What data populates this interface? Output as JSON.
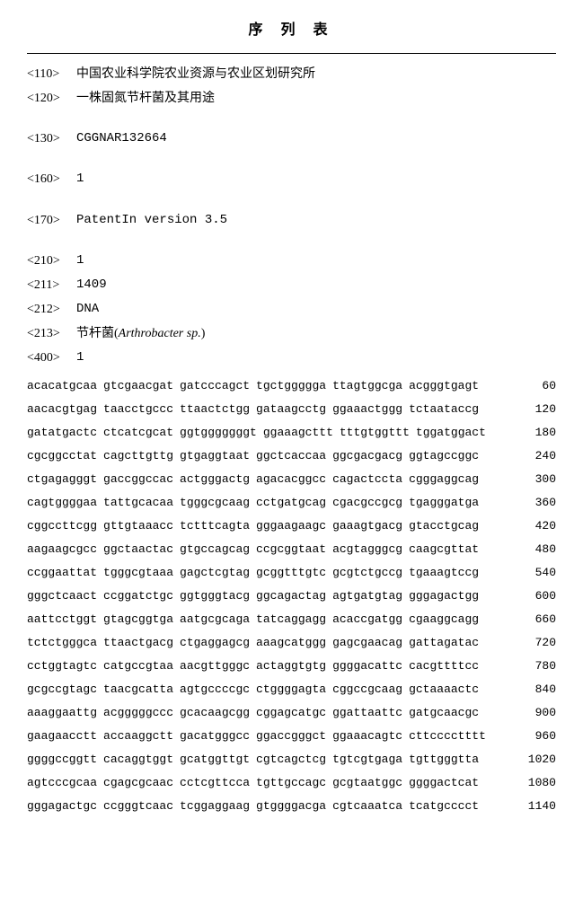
{
  "title": "序  列  表",
  "header": {
    "h110": {
      "tag": "<110>",
      "value": "中国农业科学院农业资源与农业区划研究所"
    },
    "h120": {
      "tag": "<120>",
      "value": "一株固氮节杆菌及其用途"
    },
    "h130": {
      "tag": "<130>",
      "value": "CGGNAR132664"
    },
    "h160": {
      "tag": "<160>",
      "value": "1"
    },
    "h170": {
      "tag": "<170>",
      "value": "PatentIn version 3.5"
    },
    "h210": {
      "tag": "<210>",
      "value": "1"
    },
    "h211": {
      "tag": "<211>",
      "value": "1409"
    },
    "h212": {
      "tag": "<212>",
      "value": "DNA"
    },
    "h213": {
      "tag": "<213>",
      "value_prefix": "节杆菌(",
      "value_italic": "Arthrobacter sp.",
      "value_suffix": ")"
    },
    "h400": {
      "tag": "<400>",
      "value": "1"
    }
  },
  "sequences": [
    {
      "blocks": [
        "acacatgcaa",
        "gtcgaacgat",
        "gatcccagct",
        "tgctggggga",
        "ttagtggcga",
        "acgggtgagt"
      ],
      "pos": "60"
    },
    {
      "blocks": [
        "aacacgtgag",
        "taacctgccc",
        "ttaactctgg",
        "gataagcctg",
        "ggaaactggg",
        "tctaataccg"
      ],
      "pos": "120"
    },
    {
      "blocks": [
        "gatatgactc",
        "ctcatcgcat",
        "ggtgggggggt",
        "ggaaagcttt",
        "tttgtggttt",
        "tggatggact"
      ],
      "pos": "180"
    },
    {
      "blocks": [
        "cgcggcctat",
        "cagcttgttg",
        "gtgaggtaat",
        "ggctcaccaa",
        "ggcgacgacg",
        "ggtagccggc"
      ],
      "pos": "240"
    },
    {
      "blocks": [
        "ctgagagggt",
        "gaccggccac",
        "actgggactg",
        "agacacggcc",
        "cagactccta",
        "cgggaggcag"
      ],
      "pos": "300"
    },
    {
      "blocks": [
        "cagtggggaa",
        "tattgcacaa",
        "tgggcgcaag",
        "cctgatgcag",
        "cgacgccgcg",
        "tgagggatga"
      ],
      "pos": "360"
    },
    {
      "blocks": [
        "cggccttcgg",
        "gttgtaaacc",
        "tctttcagta",
        "gggaagaagc",
        "gaaagtgacg",
        "gtacctgcag"
      ],
      "pos": "420"
    },
    {
      "blocks": [
        "aagaagcgcc",
        "ggctaactac",
        "gtgccagcag",
        "ccgcggtaat",
        "acgtagggcg",
        "caagcgttat"
      ],
      "pos": "480"
    },
    {
      "blocks": [
        "ccggaattat",
        "tgggcgtaaa",
        "gagctcgtag",
        "gcggtttgtc",
        "gcgtctgccg",
        "tgaaagtccg"
      ],
      "pos": "540"
    },
    {
      "blocks": [
        "gggctcaact",
        "ccggatctgc",
        "ggtgggtacg",
        "ggcagactag",
        "agtgatgtag",
        "gggagactgg"
      ],
      "pos": "600"
    },
    {
      "blocks": [
        "aattcctggt",
        "gtagcggtga",
        "aatgcgcaga",
        "tatcaggagg",
        "acaccgatgg",
        "cgaaggcagg"
      ],
      "pos": "660"
    },
    {
      "blocks": [
        "tctctgggca",
        "ttaactgacg",
        "ctgaggagcg",
        "aaagcatggg",
        "gagcgaacag",
        "gattagatac"
      ],
      "pos": "720"
    },
    {
      "blocks": [
        "cctggtagtc",
        "catgccgtaa",
        "aacgttgggc",
        "actaggtgtg",
        "ggggacattc",
        "cacgttttcc"
      ],
      "pos": "780"
    },
    {
      "blocks": [
        "gcgccgtagc",
        "taacgcatta",
        "agtgccccgc",
        "ctggggagta",
        "cggccgcaag",
        "gctaaaactc"
      ],
      "pos": "840"
    },
    {
      "blocks": [
        "aaaggaattg",
        "acgggggccc",
        "gcacaagcgg",
        "cggagcatgc",
        "ggattaattc",
        "gatgcaacgc"
      ],
      "pos": "900"
    },
    {
      "blocks": [
        "gaagaacctt",
        "accaaggctt",
        "gacatgggcc",
        "ggaccgggct",
        "ggaaacagtc",
        "cttcccctttt"
      ],
      "pos": "960"
    },
    {
      "blocks": [
        "ggggccggtt",
        "cacaggtggt",
        "gcatggttgt",
        "cgtcagctcg",
        "tgtcgtgaga",
        "tgttgggtta"
      ],
      "pos": "1020"
    },
    {
      "blocks": [
        "agtcccgcaa",
        "cgagcgcaac",
        "cctcgttcca",
        "tgttgccagc",
        "gcgtaatggc",
        "ggggactcat"
      ],
      "pos": "1080"
    },
    {
      "blocks": [
        "gggagactgc",
        "ccgggtcaac",
        "tcggaggaag",
        "gtggggacga",
        "cgtcaaatca",
        "tcatgcccct"
      ],
      "pos": "1140"
    }
  ]
}
